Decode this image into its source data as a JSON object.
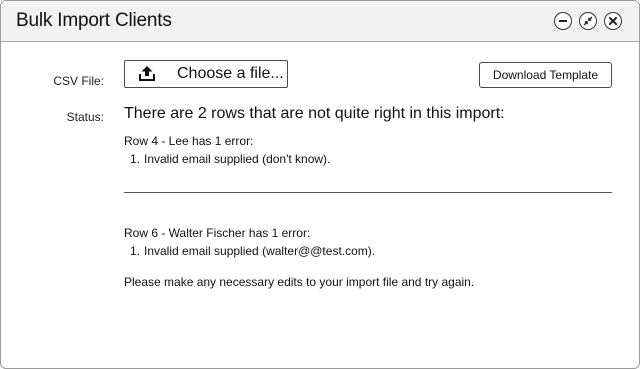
{
  "window": {
    "title": "Bulk Import Clients",
    "controls": [
      {
        "name": "minimize",
        "icon": "minus-icon"
      },
      {
        "name": "restore",
        "icon": "shrink-arrows-icon"
      },
      {
        "name": "close",
        "icon": "close-icon"
      }
    ]
  },
  "form": {
    "csv_label": "CSV File:",
    "choose_file_label": "Choose a file...",
    "choose_file_icon": "upload-icon",
    "download_template_label": "Download Template",
    "status_label": "Status:"
  },
  "status": {
    "headline": "There are 2 rows that are not quite right in this import:",
    "errors": [
      {
        "title": "Row 4 - Lee has 1 error:",
        "items": [
          {
            "num": "1.",
            "text": "Invalid email supplied (don't know)."
          }
        ]
      },
      {
        "title": "Row 6 - Walter Fischer has 1 error:",
        "items": [
          {
            "num": "1.",
            "text": "Invalid email supplied (walter@@test.com)."
          }
        ]
      }
    ],
    "footer": "Please make any necessary edits to your import file and try again."
  },
  "colors": {
    "titlebar_bg": "#f1f1f1",
    "border": "#9a9a9a",
    "text": "#111111"
  }
}
